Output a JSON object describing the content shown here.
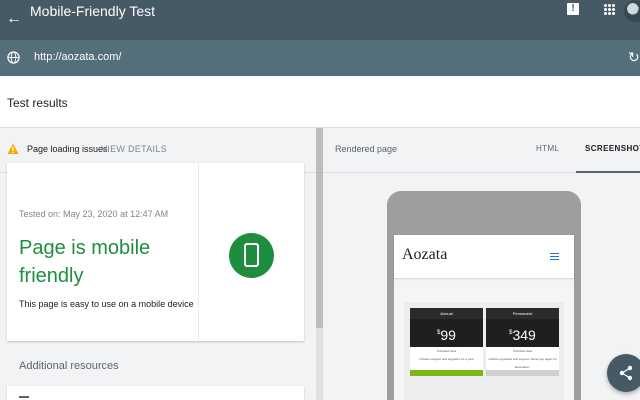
{
  "app": {
    "title": "Mobile-Friendly Test",
    "url": "http://aozata.com/"
  },
  "icons": {
    "back": "arrow-back-icon",
    "feedback": "feedback-icon",
    "apps": "apps-grid-icon",
    "globe": "globe-icon",
    "refresh": "refresh-icon",
    "warning": "warning-icon",
    "phone": "smartphone-icon",
    "menu": "hamburger-menu-icon",
    "share": "share-icon"
  },
  "colors": {
    "topbar": "#455a64",
    "urlbar": "#546e7a",
    "success": "#1e8e3e",
    "warning": "#f9ab00",
    "accent": "#1a73e8"
  },
  "results": {
    "title": "Test results",
    "issues_label": "Page loading issues",
    "view_details": "VIEW DETAILS",
    "tested_on": "Tested on: May 23, 2020 at 12:47 AM",
    "verdict": "Page is mobile friendly",
    "verdict_desc": "This page is easy to use on a mobile device",
    "additional_title": "Additional resources"
  },
  "rendered": {
    "label": "Rendered page",
    "tabs": [
      {
        "label": "HTML",
        "selected": false
      },
      {
        "label": "SCREENSHOT",
        "selected": true
      }
    ]
  },
  "site_preview": {
    "brand": "Aozata",
    "plans": [
      {
        "name": "Annual",
        "currency": "$",
        "price": "99",
        "feature_1": "Unlimited sites",
        "feature_2": "Includes support and upgrades for a year"
      },
      {
        "name": "Permanent",
        "currency": "$",
        "price": "349",
        "feature_1": "Unlimited sites",
        "feature_2": "Lifetime upgrades and support. Never pay again for Recreation."
      }
    ]
  }
}
